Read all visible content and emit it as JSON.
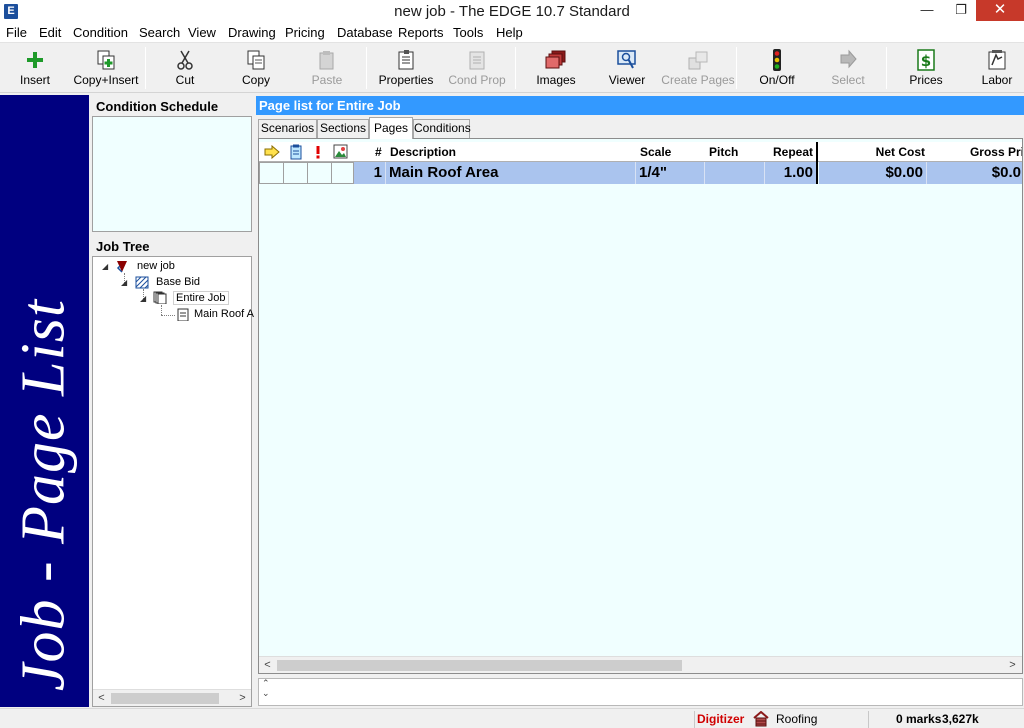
{
  "window": {
    "title": "new job - The EDGE 10.7 Standard",
    "app_icon_letter": "E",
    "minimize_glyph": "—",
    "maximize_glyph": "❐",
    "close_glyph": "✕"
  },
  "menu": [
    "File",
    "Edit",
    "Condition",
    "Search",
    "View",
    "Drawing",
    "Pricing",
    "Database",
    "Reports",
    "Tools",
    "Help"
  ],
  "toolbar": {
    "insert": "Insert",
    "copy_insert": "Copy+Insert",
    "cut": "Cut",
    "copy": "Copy",
    "paste": "Paste",
    "properties": "Properties",
    "cond_prop": "Cond Prop",
    "images": "Images",
    "viewer": "Viewer",
    "create_pages": "Create Pages",
    "on_off": "On/Off",
    "select": "Select",
    "prices": "Prices",
    "labor": "Labor"
  },
  "banner": {
    "text": "Job - Page List"
  },
  "condition_schedule": {
    "heading": "Condition Schedule"
  },
  "job_tree": {
    "heading": "Job Tree",
    "items": [
      "new job",
      "Base Bid",
      "Entire Job",
      "Main Roof A"
    ]
  },
  "page_list": {
    "header": "Page list for Entire Job",
    "tabs": [
      "Scenarios",
      "Sections",
      "Pages",
      "Conditions"
    ],
    "active_tab": "Pages",
    "columns": {
      "number": "#",
      "description": "Description",
      "scale": "Scale",
      "pitch": "Pitch",
      "repeat": "Repeat",
      "net_cost": "Net Cost",
      "gross_price": "Gross Pri"
    },
    "rows": [
      {
        "number": "1",
        "description": "Main Roof Area",
        "scale": "1/4\"",
        "pitch": "",
        "repeat": "1.00",
        "net_cost": "$0.00",
        "gross_price": "$0.0"
      }
    ]
  },
  "status": {
    "mode": "Digitizer",
    "trade": "Roofing",
    "marks": "0 marks",
    "memory": "3,627k"
  },
  "colors": {
    "banner_bg": "#000080",
    "panel_header_bg": "#3399ff",
    "grid_bg": "#f0ffff",
    "selected_row": "#aac4ee",
    "digitizer_text": "#d00000",
    "close_button": "#c7392a"
  }
}
